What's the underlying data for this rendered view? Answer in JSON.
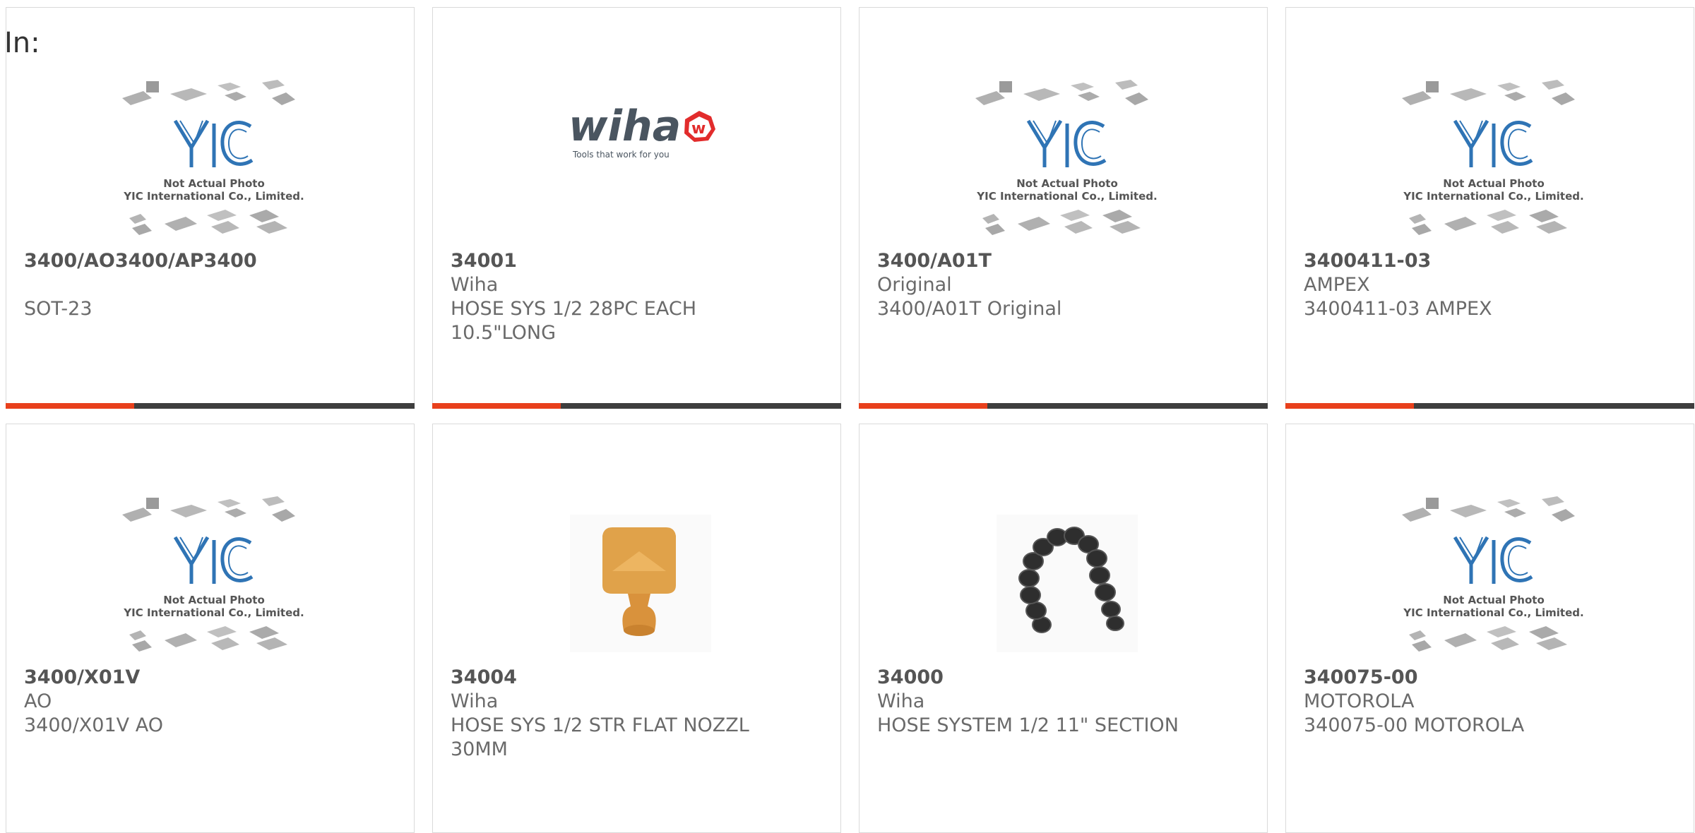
{
  "header": {
    "label": "In:"
  },
  "brand": {
    "accent_color": "#e8401c",
    "bar_color": "#3e3e3e",
    "placeholder_caption_line1": "Not Actual Photo",
    "placeholder_caption_line2": "YIC International Co., Limited.",
    "placeholder_logo": "YIC",
    "wiha_logo": "wiha",
    "wiha_tagline": "Tools that work for you"
  },
  "products": [
    {
      "part": "3400/AO3400/AP3400",
      "maker": "",
      "desc1": "SOT-23",
      "desc2": "",
      "image": "yic-placeholder"
    },
    {
      "part": "34001",
      "maker": "Wiha",
      "desc1": "HOSE SYS 1/2 28PC EACH",
      "desc2": "10.5\"LONG",
      "image": "wiha-logo"
    },
    {
      "part": "3400/A01T",
      "maker": "Original",
      "desc1": "3400/A01T Original",
      "desc2": "",
      "image": "yic-placeholder"
    },
    {
      "part": "3400411-03",
      "maker": "AMPEX",
      "desc1": "3400411-03 AMPEX",
      "desc2": "",
      "image": "yic-placeholder"
    },
    {
      "part": "3400/X01V",
      "maker": "AO",
      "desc1": "3400/X01V AO",
      "desc2": "",
      "image": "yic-placeholder"
    },
    {
      "part": "34004",
      "maker": "Wiha",
      "desc1": "HOSE SYS 1/2 STR FLAT NOZZL",
      "desc2": "30MM",
      "image": "flat-nozzle-photo"
    },
    {
      "part": "34000",
      "maker": "Wiha",
      "desc1": "HOSE SYSTEM 1/2 11\" SECTION",
      "desc2": "",
      "image": "hose-section-photo"
    },
    {
      "part": "340075-00",
      "maker": "MOTOROLA",
      "desc1": "340075-00 MOTOROLA",
      "desc2": "",
      "image": "yic-placeholder"
    }
  ]
}
